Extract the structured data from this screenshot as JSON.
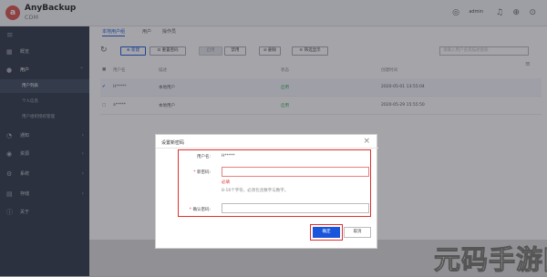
{
  "brand": {
    "logo_letter": "a",
    "name": "AnyBackup",
    "product": "CDM"
  },
  "topbar": {
    "user_label": "admin",
    "icons": [
      "user-icon",
      "bell-icon",
      "globe-icon",
      "help-icon"
    ]
  },
  "sidebar": {
    "items": [
      {
        "label": "概览",
        "icon": "grid-icon"
      },
      {
        "label": "用户",
        "icon": "user-icon"
      },
      {
        "label": "通知",
        "icon": "bell-icon"
      },
      {
        "label": "资源",
        "icon": "database-icon"
      },
      {
        "label": "系统",
        "icon": "gear-icon"
      },
      {
        "label": "存储",
        "icon": "storage-icon"
      },
      {
        "label": "关于",
        "icon": "info-icon"
      }
    ],
    "subitems": [
      "用户列表",
      "个人信息",
      "用户组织授权管理"
    ]
  },
  "tabs": [
    "本地用户组",
    "用户",
    "操作员"
  ],
  "toolbar": {
    "new": "新建",
    "reset": "重置密码",
    "enable": "启用",
    "disable": "禁用",
    "delete": "删除",
    "more": "筛选显示",
    "search_placeholder": "请输入用户名或描述搜索"
  },
  "table": {
    "headers": [
      "用户名",
      "描述",
      "状态",
      "创建时间"
    ],
    "rows": [
      {
        "name": "H*****",
        "desc": "本地用户",
        "status": "启用",
        "time": "2020-05-01 13:55:04"
      },
      {
        "name": "a*****",
        "desc": "本地用户",
        "status": "启用",
        "time": "2020-05-29 15:55:50"
      }
    ]
  },
  "dialog": {
    "title": "设置新密码",
    "username_label": "用户名:",
    "username_value": "H*****",
    "new_pwd_label": "新密码:",
    "error": "必填",
    "hint": "8-16个字符，必须包含数字与数字。",
    "confirm_label": "确认密码:",
    "ok": "确定",
    "cancel": "取消"
  },
  "watermark": "元码手游网",
  "colors": {
    "accent": "#1a56db",
    "error": "#e03030",
    "sidebar": "#2d3748",
    "status_green": "#29a745"
  }
}
